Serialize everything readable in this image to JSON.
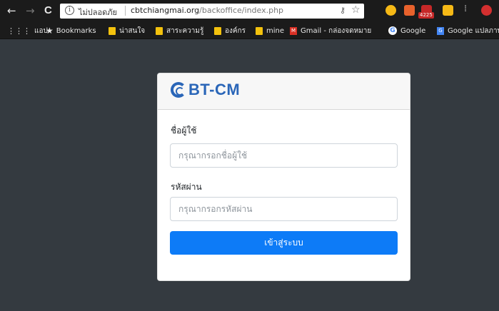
{
  "browser": {
    "security_label": "ไม่ปลอดภัย",
    "url_domain": "cbtchiangmai.org",
    "url_path": "/backoffice/index.php",
    "nav": {
      "back": "←",
      "forward": "→",
      "reload": "C"
    },
    "extension_badge": "4225"
  },
  "bookmarks": [
    {
      "label": "แอป",
      "icon": "apps-icon"
    },
    {
      "label": "Bookmarks",
      "icon": "star-icon"
    },
    {
      "label": "น่าสนใจ",
      "icon": "folder-icon"
    },
    {
      "label": "สาระความรู้",
      "icon": "folder-icon"
    },
    {
      "label": "องค์กร",
      "icon": "folder-icon"
    },
    {
      "label": "mine",
      "icon": "folder-icon"
    },
    {
      "label": "Gmail - กล่องจดหมาย",
      "icon": "gmail-icon"
    },
    {
      "label": "Google",
      "icon": "google-icon"
    },
    {
      "label": "Google แปลภาษา",
      "icon": "google-translate-icon"
    }
  ],
  "login": {
    "logo_text": "BT-CM",
    "username_label": "ชื่อผู้ใช้",
    "username_placeholder": "กรุณากรอกชื่อผู้ใช้",
    "username_value": "",
    "password_label": "รหัสผ่าน",
    "password_placeholder": "กรุณากรอกรหัสผ่าน",
    "password_value": "",
    "submit_label": "เข้าสู่ระบบ"
  },
  "colors": {
    "background": "#343a40",
    "primary_button": "#0d7bf7",
    "logo_blue": "#2a66b8"
  }
}
